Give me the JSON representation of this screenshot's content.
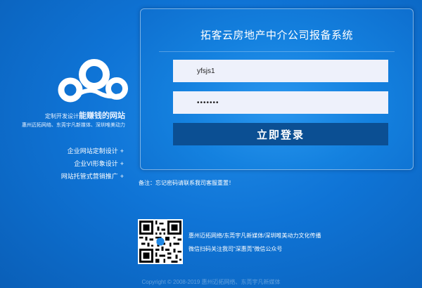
{
  "brand": {
    "tagline_small": "定制开发设计",
    "tagline_bold": "能赚钱的网站",
    "companies": "惠州迈拓网络、东莞宇凡新媒体、深圳唯美动力",
    "services": [
      {
        "label": "企业网站定制设计",
        "plus": "+"
      },
      {
        "label": "企业VI形象设计",
        "plus": "+"
      },
      {
        "label": "网站托管式营销推广",
        "plus": "+"
      }
    ]
  },
  "login": {
    "title": "拓客云房地产中介公司报备系统",
    "username_value": "yfsjs1",
    "password_value": "•••••••",
    "submit_label": "立即登录"
  },
  "note": "备注：忘记密码请联系我司客服重置！",
  "qr": {
    "line1": "惠州迈拓网络/东莞宇凡新媒体/深圳唯美动力文化传播",
    "line2": "微信扫码关注我司“深惠莞”微信公众号"
  },
  "footer": {
    "copyright": "Copyright © 2008-2019 惠州迈拓网络、东莞宇凡新媒体"
  },
  "colors": {
    "background": "#0f74d6",
    "button": "#0b4f93",
    "input_bg": "#eef1fb"
  }
}
